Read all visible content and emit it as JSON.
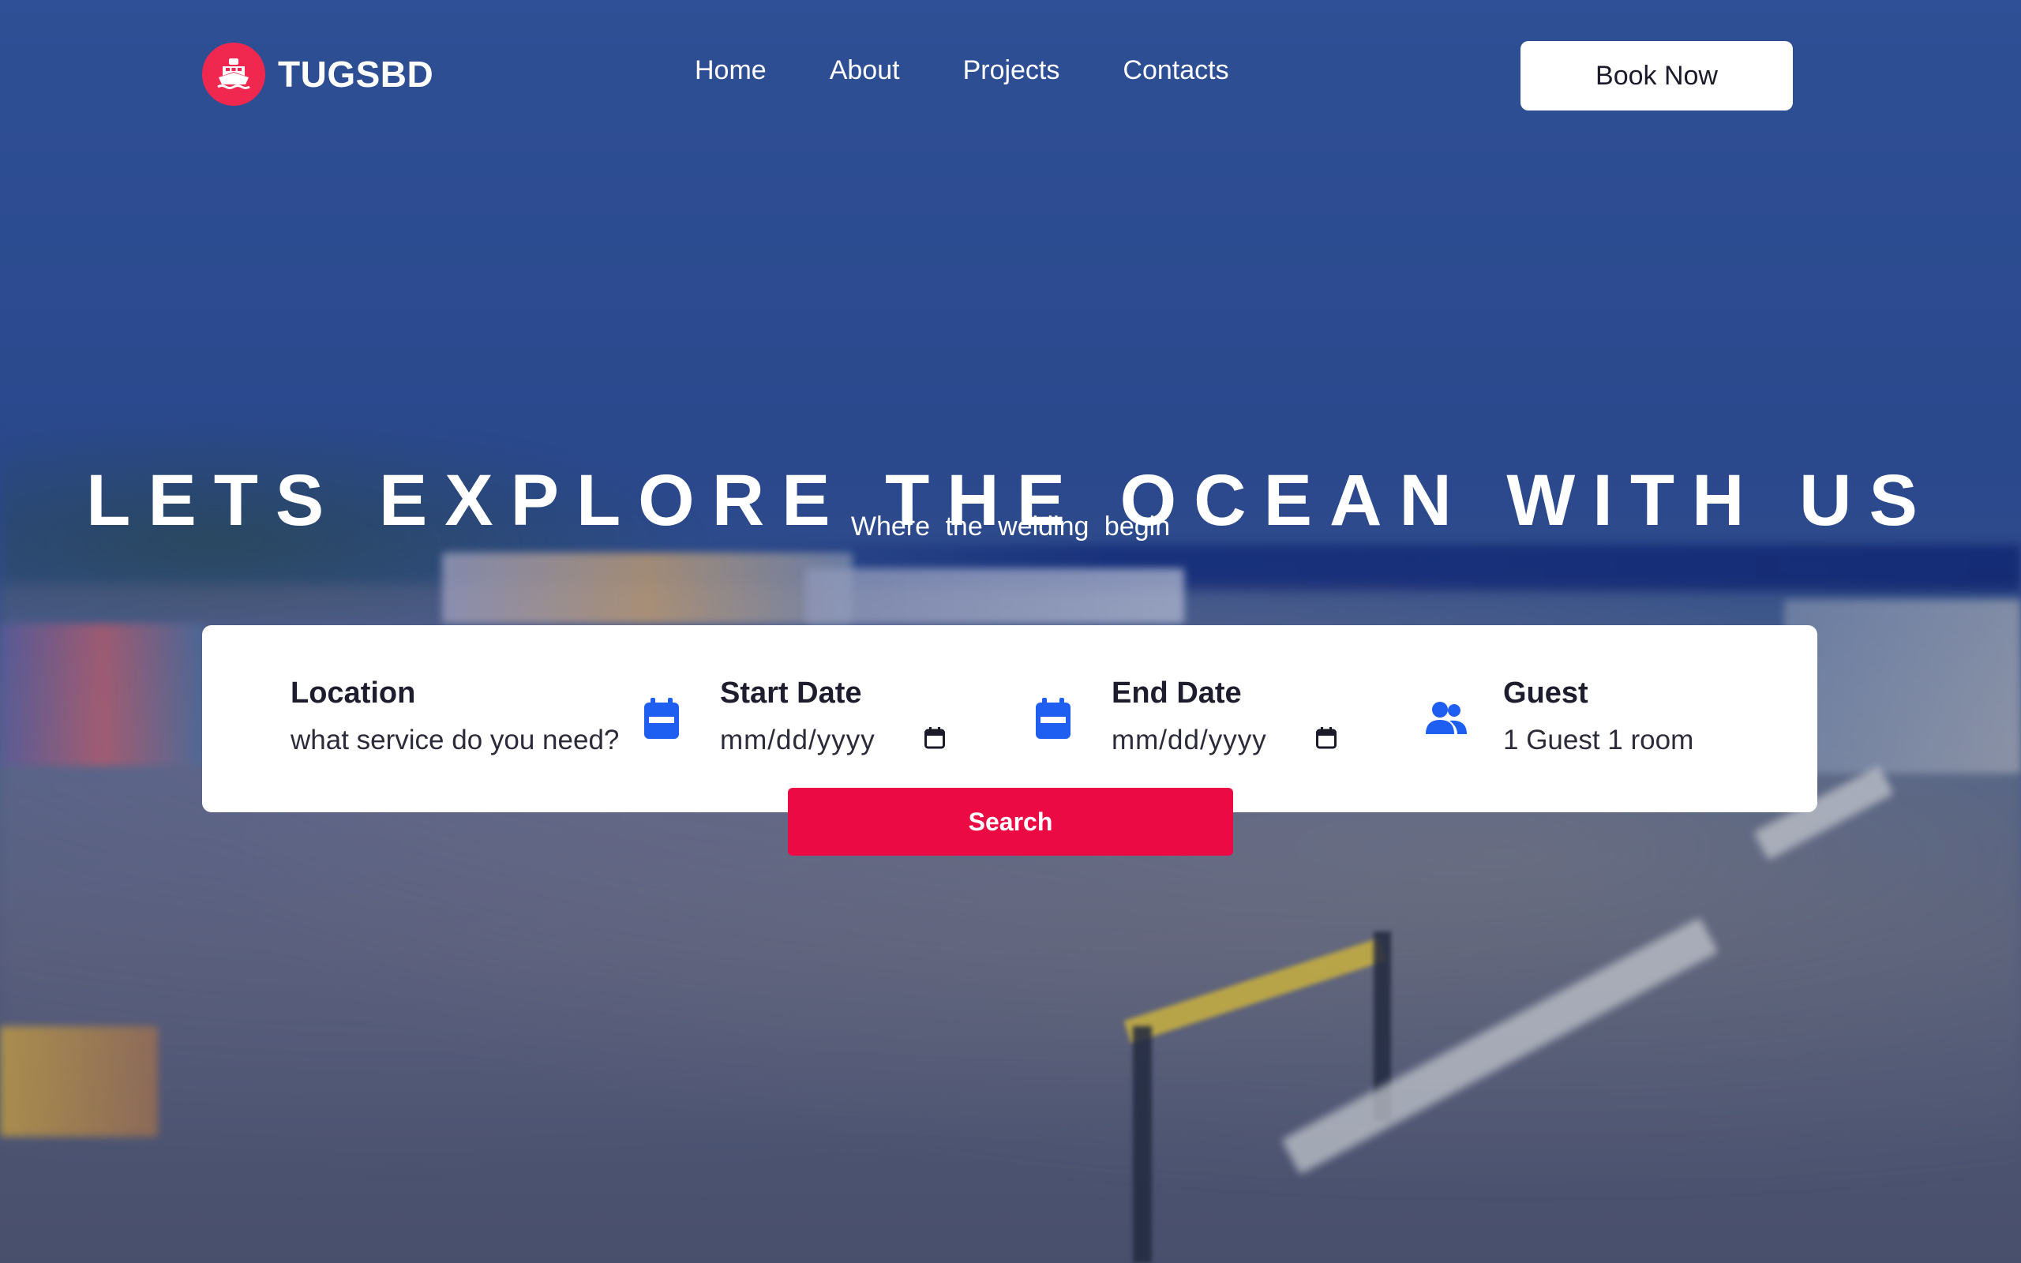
{
  "brand": {
    "name": "TUGSBD",
    "accent_color": "#f0284f",
    "icon": "ship-icon"
  },
  "nav": {
    "items": [
      "Home",
      "About",
      "Projects",
      "Contacts"
    ],
    "cta_label": "Book Now"
  },
  "hero": {
    "title": "LETS EXPLORE THE OCEAN WITH US",
    "subtitle": "Where the welding begin"
  },
  "search": {
    "location": {
      "label": "Location",
      "placeholder": "what service do you need?"
    },
    "start_date": {
      "label": "Start Date",
      "value": "mm/dd/yyyy",
      "icon": "calendar-icon"
    },
    "end_date": {
      "label": "End Date",
      "value": "mm/dd/yyyy",
      "icon": "calendar-icon"
    },
    "guest": {
      "label": "Guest",
      "value": "1 Guest 1 room",
      "icon": "users-icon"
    },
    "button_label": "Search",
    "button_color": "#ec0a44",
    "icon_color": "#1e5ef0"
  }
}
